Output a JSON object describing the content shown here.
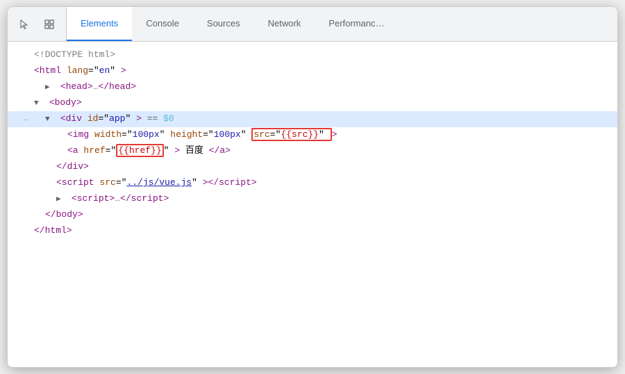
{
  "tabs": {
    "icons": [
      {
        "name": "cursor-icon",
        "unicode": "↖",
        "active": false
      },
      {
        "name": "inspect-icon",
        "unicode": "⬜",
        "active": false
      }
    ],
    "items": [
      {
        "label": "Elements",
        "active": true
      },
      {
        "label": "Console",
        "active": false
      },
      {
        "label": "Sources",
        "active": false
      },
      {
        "label": "Network",
        "active": false
      },
      {
        "label": "Performance",
        "active": false
      }
    ]
  },
  "code": {
    "lines": [
      {
        "indent": 0,
        "content": "doctype"
      },
      {
        "indent": 0,
        "content": "html_open"
      },
      {
        "indent": 0,
        "content": "head"
      },
      {
        "indent": 0,
        "content": "body_open"
      },
      {
        "indent": 1,
        "content": "div_app"
      },
      {
        "indent": 2,
        "content": "img"
      },
      {
        "indent": 2,
        "content": "a_href"
      },
      {
        "indent": 1,
        "content": "div_close"
      },
      {
        "indent": 1,
        "content": "script_src"
      },
      {
        "indent": 1,
        "content": "script_short"
      },
      {
        "indent": 0,
        "content": "body_close"
      },
      {
        "indent": 0,
        "content": "html_close"
      }
    ]
  }
}
